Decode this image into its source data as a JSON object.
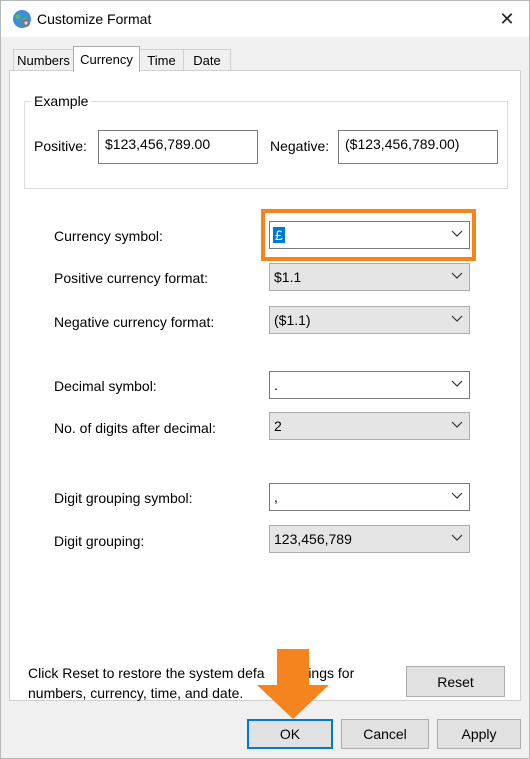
{
  "window": {
    "title": "Customize Format",
    "icon": "globe-icon",
    "close_glyph": "✕"
  },
  "tabs": [
    {
      "label": "Numbers",
      "active": false
    },
    {
      "label": "Currency",
      "active": true
    },
    {
      "label": "Time",
      "active": false
    },
    {
      "label": "Date",
      "active": false
    }
  ],
  "example": {
    "group_label": "Example",
    "positive_label": "Positive:",
    "positive_value": "$123,456,789.00",
    "negative_label": "Negative:",
    "negative_value": "($123,456,789.00)"
  },
  "fields": {
    "currency_symbol": {
      "label": "Currency symbol:",
      "value": "£"
    },
    "positive_format": {
      "label": "Positive currency format:",
      "value": "$1.1"
    },
    "negative_format": {
      "label": "Negative currency format:",
      "value": "($1.1)"
    },
    "decimal_symbol": {
      "label": "Decimal symbol:",
      "value": "."
    },
    "digits_after_decimal": {
      "label": "No. of digits after decimal:",
      "value": "2"
    },
    "digit_grouping_symbol": {
      "label": "Digit grouping symbol:",
      "value": ","
    },
    "digit_grouping": {
      "label": "Digit grouping:",
      "value": "123,456,789"
    }
  },
  "footer": {
    "reset_hint_line1": "Click Reset to restore the system defa",
    "reset_hint_line1_tail": "ttings for",
    "reset_hint_line2": "numbers, currency, time, and date.",
    "reset_label": "Reset"
  },
  "buttons": {
    "ok": "OK",
    "cancel": "Cancel",
    "apply": "Apply"
  },
  "colors": {
    "annotation_orange": "#f5841f",
    "accent_blue": "#0078d7"
  }
}
